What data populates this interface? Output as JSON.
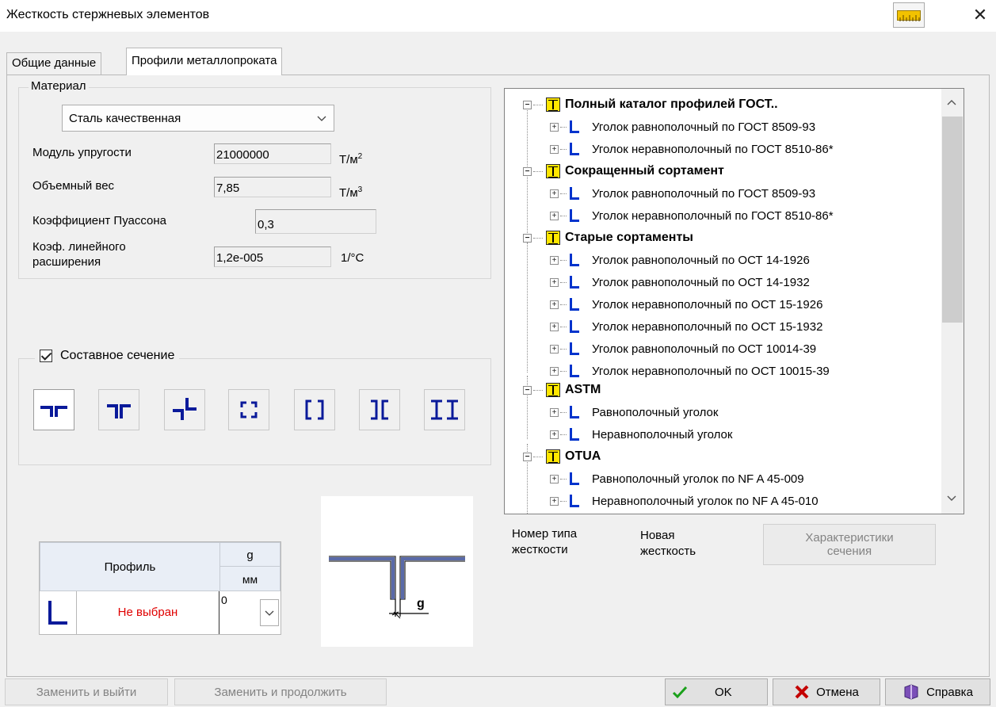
{
  "window": {
    "title": "Жесткость стержневых элементов",
    "close_glyph": "✕",
    "ruler_icon": "ruler-icon"
  },
  "tabs": [
    {
      "label": "Общие данные",
      "active": false
    },
    {
      "label": "Профили металлопроката",
      "active": true
    }
  ],
  "material": {
    "legend": "Материал",
    "selected": "Сталь качественная",
    "elastic_modulus": {
      "label": "Модуль упругости",
      "value": "21000000",
      "unit": "Т/м",
      "unit_sup": "2"
    },
    "volume_weight": {
      "label": "Объемный вес",
      "value": "7,85",
      "unit": "Т/м",
      "unit_sup": "3"
    },
    "poisson": {
      "label": "Коэффициент Пуассона",
      "value": "0,3"
    },
    "thermal": {
      "label_line1": "Коэф. линейного",
      "label_line2": "расширения",
      "value": "1,2e-005",
      "unit": "1/°C"
    }
  },
  "composite": {
    "label": "Составное сечение",
    "checked": true,
    "section_types": [
      "two-angles-back-to-back-icon",
      "two-angles-tee-icon",
      "two-angles-cross-icon",
      "four-angles-box-icon",
      "two-channels-box-icon",
      "two-channels-back-icon",
      "two-ibeams-icon"
    ]
  },
  "profile_table": {
    "header_profile": "Профиль",
    "header_g": "g",
    "header_unit": "мм",
    "profile_value": "Не выбран",
    "g_value": "0"
  },
  "preview": {
    "dimension_label": "g"
  },
  "tree": {
    "groups": [
      {
        "label": "Полный каталог профилей ГОСТ..",
        "items": [
          "Уголок равнополочный по ГОСТ 8509-93",
          "Уголок неравнополочный по ГОСТ 8510-86*"
        ]
      },
      {
        "label": "Сокращенный сортамент",
        "items": [
          "Уголок равнополочный по ГОСТ 8509-93",
          "Уголок неравнополочный по ГОСТ 8510-86*"
        ]
      },
      {
        "label": "Старые сортаменты",
        "items": [
          "Уголок равнополочный по ОСТ 14-1926",
          "Уголок равнополочный по ОСТ 14-1932",
          "Уголок неравнополочный по ОСТ 15-1926",
          "Уголок неравнополочный по ОСТ 15-1932",
          "Уголок равнополочный по ОСТ 10014-39",
          "Уголок неравнополочный по ОСТ 10015-39"
        ]
      },
      {
        "label": "ASTM",
        "items": [
          "Равнополочный уголок",
          "Неравнополочный уголок"
        ]
      },
      {
        "label": "OTUA",
        "items": [
          "Равнополочный уголок по NF A 45-009",
          "Неравнополочный уголок  по NF A 45-010"
        ]
      }
    ]
  },
  "info": {
    "type_number_label_1": "Номер типа",
    "type_number_label_2": "жесткости",
    "new_stiffness_1": "Новая",
    "new_stiffness_2": "жесткость",
    "section_props_1": "Характеристики",
    "section_props_2": "сечения"
  },
  "buttons": {
    "replace_exit": "Заменить и выйти",
    "replace_continue": "Заменить и продолжить",
    "ok": "OK",
    "cancel": "Отмена",
    "help": "Справка"
  },
  "colors": {
    "accent_blue": "#0033cc",
    "not_selected_red": "#e00000",
    "catalog_yellow": "#ffe600",
    "ok_green": "#1aa01a",
    "cancel_red": "#c40000"
  }
}
